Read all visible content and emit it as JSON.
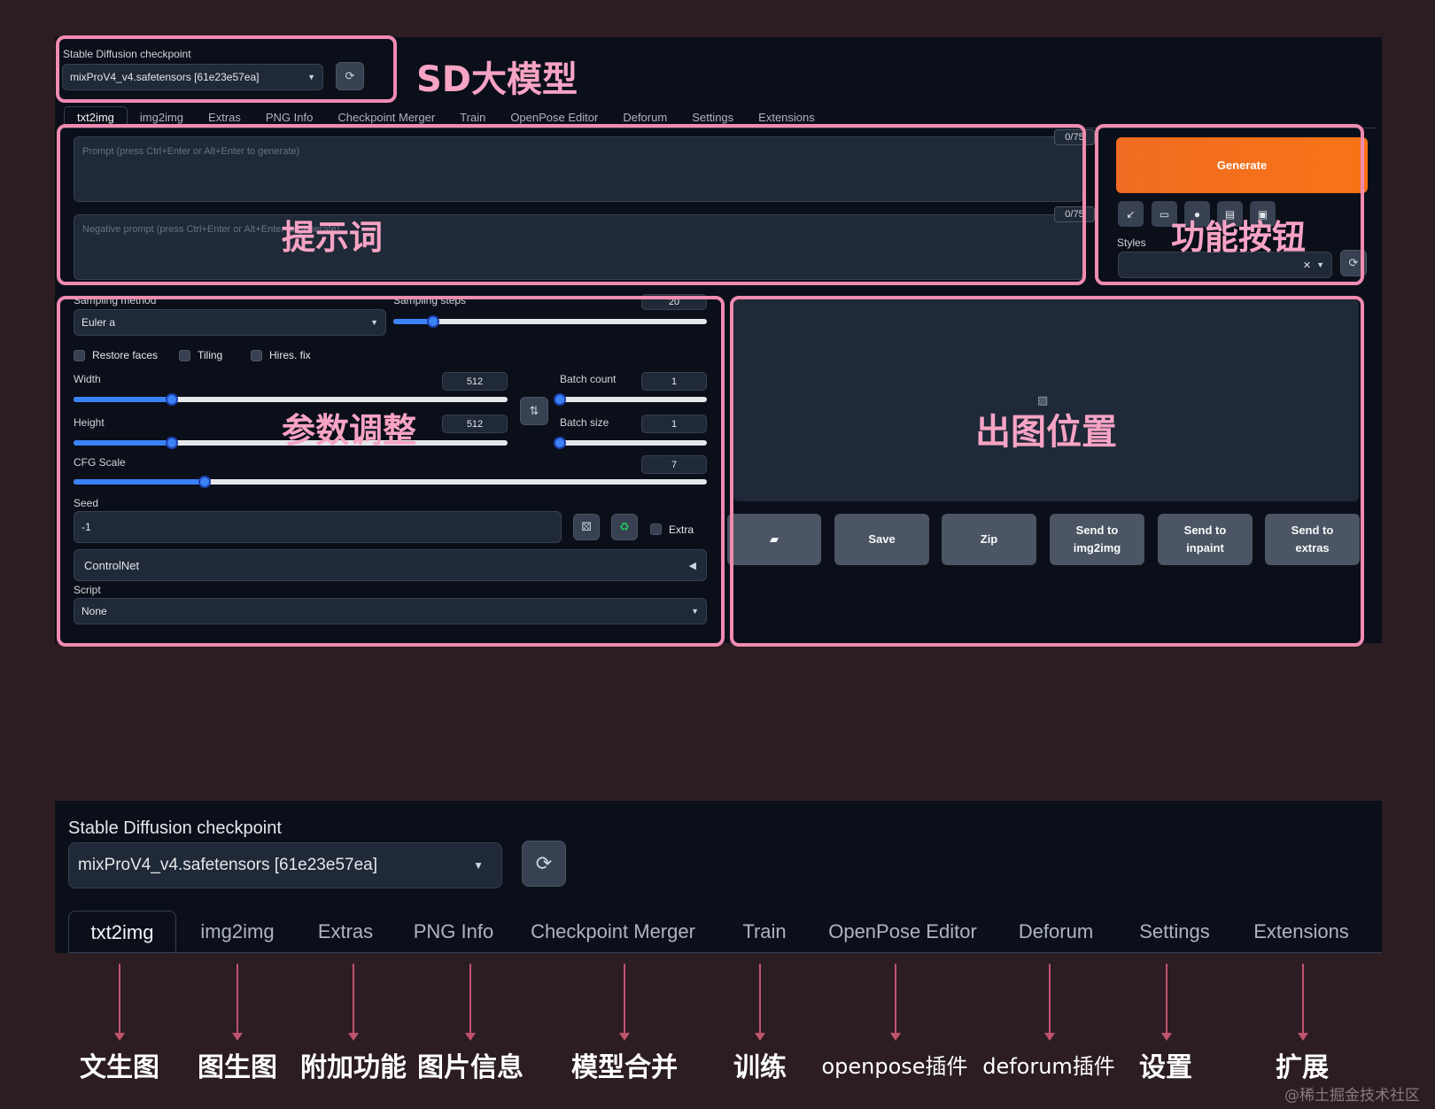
{
  "checkpoint": {
    "label": "Stable Diffusion checkpoint",
    "value": "mixProV4_v4.safetensors [61e23e57ea]",
    "refresh_icon": "refresh-icon"
  },
  "tabs": [
    "txt2img",
    "img2img",
    "Extras",
    "PNG Info",
    "Checkpoint Merger",
    "Train",
    "OpenPose Editor",
    "Deforum",
    "Settings",
    "Extensions"
  ],
  "prompt": {
    "placeholder": "Prompt (press Ctrl+Enter or Alt+Enter to generate)",
    "negative_placeholder": "Negative prompt (press Ctrl+Enter or Alt+Enter to generate)",
    "counter": "0/75",
    "negative_counter": "0/75"
  },
  "actions": {
    "generate": "Generate",
    "styles_label": "Styles",
    "clear": "✕",
    "tools": [
      "arrow-icon",
      "trash-icon",
      "palette-icon",
      "clipboard-icon",
      "save-icon"
    ]
  },
  "params": {
    "sampling_method_label": "Sampling method",
    "sampling_method": "Euler a",
    "sampling_steps_label": "Sampling steps",
    "sampling_steps": 20,
    "restore_faces": "Restore faces",
    "tiling": "Tiling",
    "hires_fix": "Hires. fix",
    "width_label": "Width",
    "width": 512,
    "height_label": "Height",
    "height": 512,
    "batch_count_label": "Batch count",
    "batch_count": 1,
    "batch_size_label": "Batch size",
    "batch_size": 1,
    "cfg_label": "CFG Scale",
    "cfg": 7,
    "seed_label": "Seed",
    "seed": "-1",
    "extra": "Extra",
    "controlnet": "ControlNet",
    "script_label": "Script",
    "script": "None"
  },
  "output": {
    "buttons": [
      "Save",
      "Zip",
      "Send to img2img",
      "Send to inpaint",
      "Send to extras"
    ]
  },
  "annotations": {
    "sd_model": "SD大模型",
    "prompt": "提示词",
    "buttons": "功能按钮",
    "params": "参数调整",
    "output": "出图位置"
  },
  "zoom": {
    "label": "Stable Diffusion checkpoint",
    "value": "mixProV4_v4.safetensors [61e23e57ea]",
    "tabs": [
      "txt2img",
      "img2img",
      "Extras",
      "PNG Info",
      "Checkpoint Merger",
      "Train",
      "OpenPose Editor",
      "Deforum",
      "Settings",
      "Extensions"
    ],
    "translations": [
      "文生图",
      "图生图",
      "附加功能",
      "图片信息",
      "模型合并",
      "训练",
      "openpose插件",
      "deforum插件",
      "设置",
      "扩展"
    ]
  },
  "watermark": "@稀土掘金技术社区"
}
